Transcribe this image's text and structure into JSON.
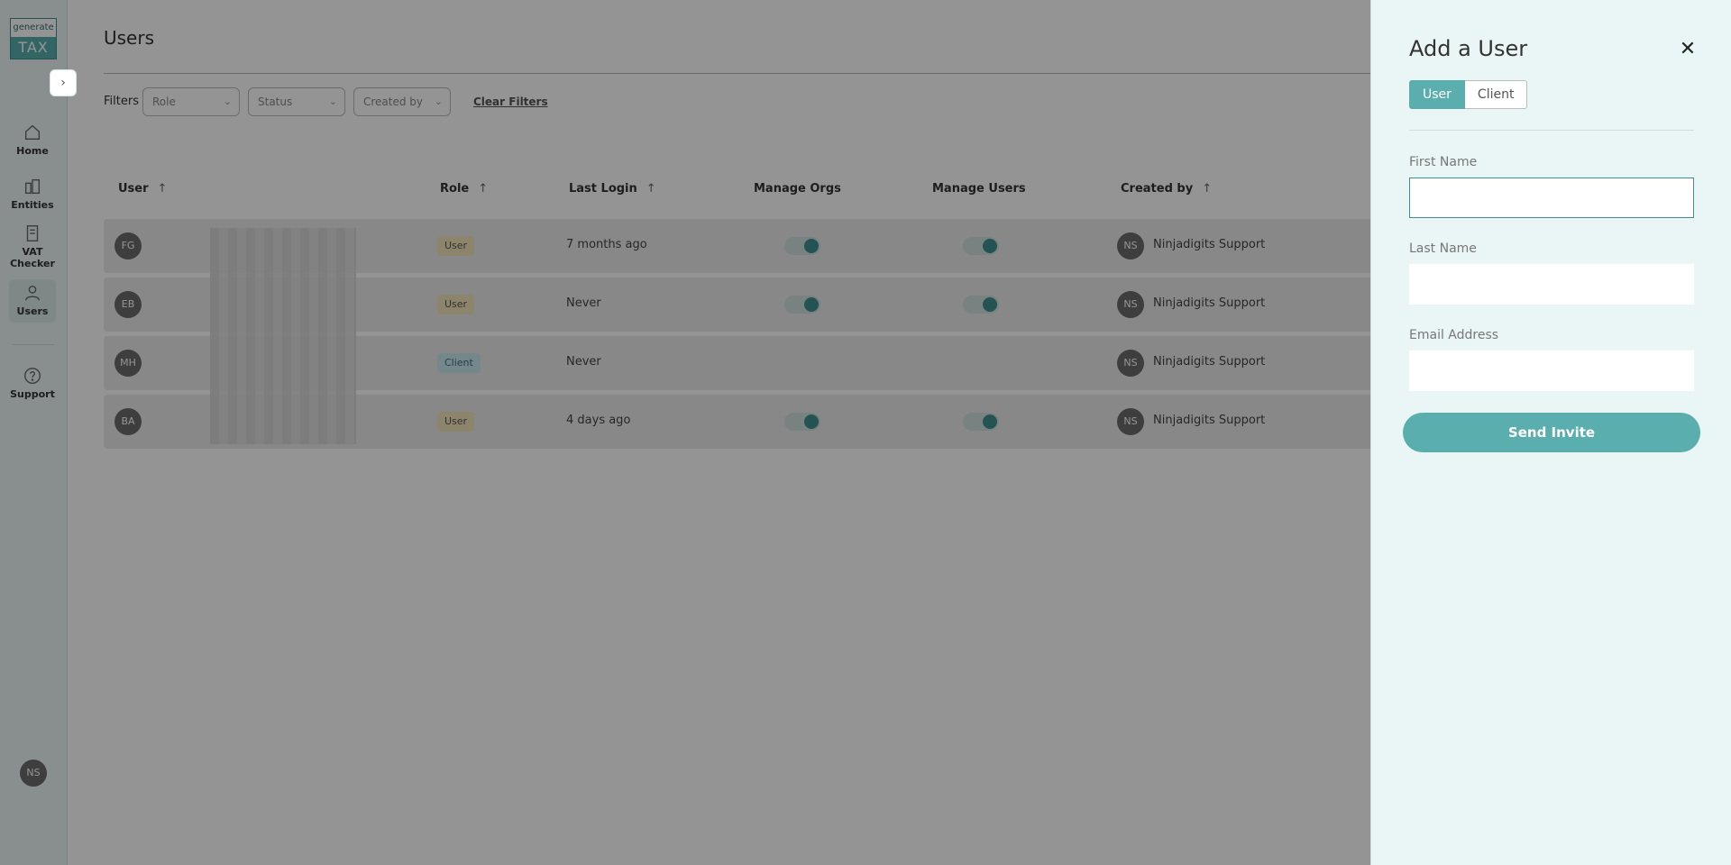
{
  "sidebar": {
    "logo_top": "generate",
    "logo_bottom": "TAX",
    "expand_icon": "chevron-right-icon",
    "items": [
      {
        "label": "Home",
        "icon": "home-icon"
      },
      {
        "label": "Entities",
        "icon": "building-icon"
      },
      {
        "label": "VAT Checker",
        "icon": "document-icon"
      },
      {
        "label": "Users",
        "icon": "user-icon"
      },
      {
        "label": "Support",
        "icon": "question-icon"
      }
    ],
    "avatar": "NS"
  },
  "page": {
    "title": "Users",
    "filters_label": "Filters",
    "filters": [
      {
        "label": "Role"
      },
      {
        "label": "Status"
      },
      {
        "label": "Created by"
      }
    ],
    "clear_filters": "Clear Filters"
  },
  "table": {
    "columns": [
      "User",
      "Role",
      "Last Login",
      "Manage Orgs",
      "Manage Users",
      "Created by"
    ],
    "rows": [
      {
        "initials": "FG",
        "role": "User",
        "last_login": "7 months ago",
        "manage_orgs": true,
        "manage_users": true,
        "created_by_initials": "NS",
        "created_by": "Ninjadigits Support"
      },
      {
        "initials": "EB",
        "role": "User",
        "last_login": "Never",
        "manage_orgs": true,
        "manage_users": true,
        "created_by_initials": "NS",
        "created_by": "Ninjadigits Support"
      },
      {
        "initials": "MH",
        "role": "Client",
        "last_login": "Never",
        "manage_orgs": false,
        "manage_users": false,
        "created_by_initials": "NS",
        "created_by": "Ninjadigits Support"
      },
      {
        "initials": "BA",
        "role": "User",
        "last_login": "4 days ago",
        "manage_orgs": true,
        "manage_users": true,
        "created_by_initials": "NS",
        "created_by": "Ninjadigits Support"
      }
    ]
  },
  "panel": {
    "title": "Add a User",
    "close_icon": "close-icon",
    "type_options": [
      "User",
      "Client"
    ],
    "selected_type": "User",
    "first_name_label": "First Name",
    "first_name_value": "",
    "last_name_label": "Last Name",
    "last_name_value": "",
    "email_label": "Email Address",
    "email_value": "",
    "submit_label": "Send Invite"
  },
  "colors": {
    "accent": "#5aaeae",
    "accent_dark": "#3f8f8f",
    "panel_bg": "#eaf6f5",
    "user_badge": "#f2e6b8",
    "client_badge": "#c9e9ef"
  }
}
